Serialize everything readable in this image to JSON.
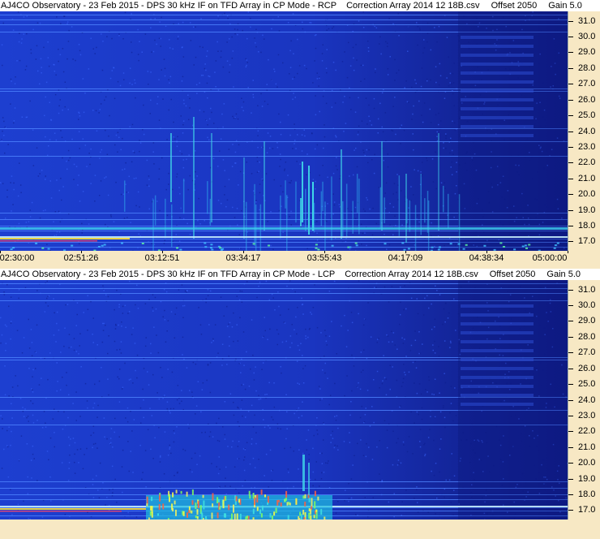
{
  "chart_data": [
    {
      "type": "heatmap",
      "title_parts": [
        "AJ4CO Observatory - 23 Feb 2015 - DPS 30 kHz IF on TFD Array in CP Mode - RCP",
        "Correction Array 2014 12 18B.csv",
        "Offset 2050",
        "Gain 5.0"
      ],
      "y_ticks": [
        "31.0",
        "30.0",
        "29.0",
        "28.0",
        "27.0",
        "26.0",
        "25.0",
        "24.0",
        "23.0",
        "22.0",
        "21.0",
        "20.0",
        "19.0",
        "18.0",
        "17.0"
      ],
      "x_ticks": [
        "02:30:00",
        "02:51:26",
        "03:12:51",
        "03:34:17",
        "03:55:43",
        "04:17:09",
        "04:38:34",
        "05:00:00"
      ],
      "ylim": [
        16.4,
        31.6
      ]
    },
    {
      "type": "heatmap",
      "title_parts": [
        "AJ4CO Observatory - 23 Feb 2015 - DPS 30 kHz IF on TFD Array in CP Mode - LCP",
        "Correction Array 2014 12 18B.csv",
        "Offset 2050",
        "Gain 5.0"
      ],
      "y_ticks": [
        "31.0",
        "30.0",
        "29.0",
        "28.0",
        "27.0",
        "26.0",
        "25.0",
        "24.0",
        "23.0",
        "22.0",
        "21.0",
        "20.0",
        "19.0",
        "18.0",
        "17.0"
      ],
      "x_ticks": [],
      "ylim": [
        16.4,
        31.6
      ]
    }
  ],
  "colors": {
    "background": "#1a38c8",
    "axis_bg": "#f7e8c4",
    "hot": "#ffff40",
    "warm": "#30e0e0"
  }
}
